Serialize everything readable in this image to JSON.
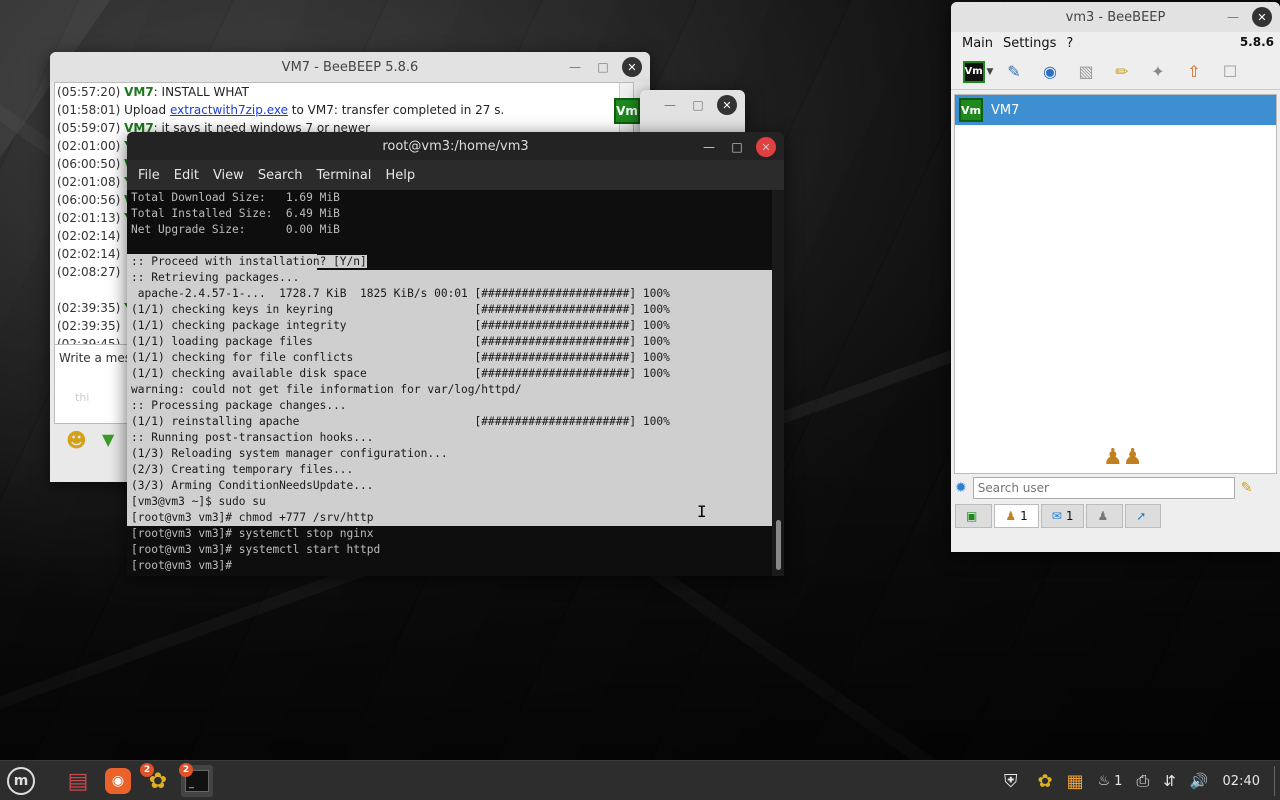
{
  "vm7_window": {
    "title": "VM7 - BeeBEEP 5.8.6",
    "badge": "Vm",
    "chat": [
      {
        "ts": "(05:57:20)",
        "user": "VM7",
        "text": ": INSTALL WHAT"
      },
      {
        "ts": "(01:58:01)",
        "user": "",
        "pre": " Upload ",
        "link": "extractwith7zip.exe",
        "text": " to VM7: transfer completed in 27 s."
      },
      {
        "ts": "(05:59:07)",
        "user": "VM7",
        "text": ": it says it need windows 7 or newer"
      },
      {
        "ts": "(02:01:00)",
        "user": "Y",
        "text": ""
      },
      {
        "ts": "(06:00:50)",
        "user": "V",
        "text": ""
      },
      {
        "ts": "(02:01:08)",
        "user": "Y",
        "text": ""
      },
      {
        "ts": "(06:00:56)",
        "user": "V",
        "text": ""
      },
      {
        "ts": "(02:01:13)",
        "user": "Y",
        "text": ""
      },
      {
        "ts": "(02:02:14)",
        "user": "",
        "text": ""
      },
      {
        "ts": "(02:02:14)",
        "user": "",
        "text": ""
      },
      {
        "ts": "(02:08:27)",
        "user": "",
        "text": ""
      },
      {
        "ts": "",
        "user": "",
        "text": ""
      },
      {
        "ts": "(02:39:35)",
        "user": "Y",
        "text": ""
      },
      {
        "ts": "(02:39:35)",
        "user": "",
        "text": ""
      },
      {
        "ts": "(02:39:45)",
        "user": "",
        "text": ""
      }
    ],
    "message_placeholder": "Write a mes",
    "message_draft": "thi"
  },
  "terminal": {
    "title": "root@vm3:/home/vm3",
    "menu": [
      "File",
      "Edit",
      "View",
      "Search",
      "Terminal",
      "Help"
    ],
    "lines": [
      {
        "text": "Total Download Size:   1.69 MiB",
        "sel": "none"
      },
      {
        "text": "Total Installed Size:  6.49 MiB",
        "sel": "none"
      },
      {
        "text": "Net Upgrade Size:      0.00 MiB",
        "sel": "none"
      },
      {
        "text": "",
        "sel": "none"
      },
      {
        "text": ":: Proceed with installation? [Y/n]",
        "sel": "partial"
      },
      {
        "text": ":: Retrieving packages...",
        "sel": "full"
      },
      {
        "text": " apache-2.4.57-1-...  1728.7 KiB  1825 KiB/s 00:01 [######################] 100%",
        "sel": "full"
      },
      {
        "text": "(1/1) checking keys in keyring                     [######################] 100%",
        "sel": "full"
      },
      {
        "text": "(1/1) checking package integrity                   [######################] 100%",
        "sel": "full"
      },
      {
        "text": "(1/1) loading package files                        [######################] 100%",
        "sel": "full"
      },
      {
        "text": "(1/1) checking for file conflicts                  [######################] 100%",
        "sel": "full"
      },
      {
        "text": "(1/1) checking available disk space                [######################] 100%",
        "sel": "full"
      },
      {
        "text": "warning: could not get file information for var/log/httpd/",
        "sel": "full"
      },
      {
        "text": ":: Processing package changes...",
        "sel": "full"
      },
      {
        "text": "(1/1) reinstalling apache                          [######################] 100%",
        "sel": "full"
      },
      {
        "text": ":: Running post-transaction hooks...",
        "sel": "full"
      },
      {
        "text": "(1/3) Reloading system manager configuration...",
        "sel": "full"
      },
      {
        "text": "(2/3) Creating temporary files...",
        "sel": "full"
      },
      {
        "text": "(3/3) Arming ConditionNeedsUpdate...",
        "sel": "full"
      },
      {
        "text": "[vm3@vm3 ~]$ sudo su",
        "sel": "full"
      },
      {
        "text": "[root@vm3 vm3]# chmod +777 /srv/http",
        "sel": "full"
      },
      {
        "text": "[root@vm3 vm3]# systemctl stop nginx",
        "sel": "none"
      },
      {
        "text": "[root@vm3 vm3]# systemctl start httpd",
        "sel": "none"
      },
      {
        "text": "[root@vm3 vm3]#",
        "sel": "none"
      }
    ]
  },
  "vm3_window": {
    "title": "vm3 - BeeBEEP",
    "menu": [
      "Main",
      "Settings",
      "?"
    ],
    "version": "5.8.6",
    "users": [
      {
        "badge": "Vm",
        "name": "VM7"
      }
    ],
    "search_placeholder": "Search user",
    "tabs": [
      {
        "icon": "monitor-icon",
        "count": ""
      },
      {
        "icon": "users-icon",
        "count": "1"
      },
      {
        "icon": "chat-icon",
        "count": "1"
      },
      {
        "icon": "group-icon",
        "count": ""
      },
      {
        "icon": "share-icon",
        "count": ""
      }
    ]
  },
  "taskbar": {
    "badges": {
      "beebeep": "2",
      "terminal": "2"
    },
    "notifications": "1",
    "clock": "02:40"
  }
}
